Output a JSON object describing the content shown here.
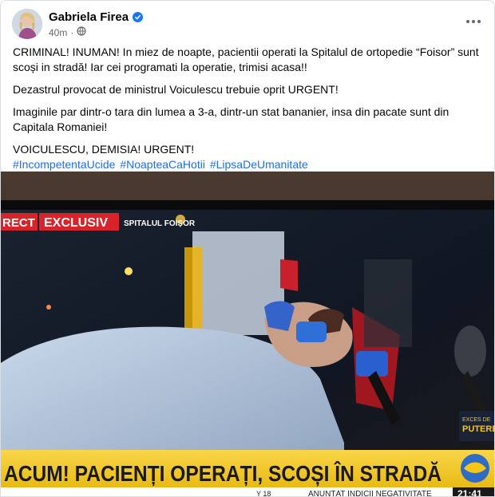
{
  "post": {
    "author": "Gabriela Firea",
    "time": "40m",
    "separator": "·",
    "paragraphs": [
      "CRIMINAL! INUMAN! In miez de noapte, pacientii operati la Spitalul de ortopedie “Foisor” sunt scoși in stradă! Iar cei programati la operatie, trimisi acasa!!",
      "Dezastrul provocat de ministrul Voiculescu trebuie oprit URGENT!",
      "Imaginile par dintr-o tara din lumea a 3-a, dintr-un stat bananier, insa din pacate sunt din Capitala Romaniei!",
      "VOICULESCU, DEMISIA! URGENT!"
    ],
    "hashtags": [
      "#IncompetentaUcide",
      "#NoapteaCaHotii",
      "#LipsaDeUmanitate"
    ]
  },
  "video": {
    "live_label": "RECT",
    "exclusive_label": "EXCLUSIV",
    "location": "SPITALUL FOIȘOR",
    "headline": "ACUM! PACIENȚI OPERAȚI, SCOȘI ÎN STRADĂ",
    "ticker": "ANUNȚAT INDICII NEGATIVITATE",
    "ticker_prefix": "Y 18",
    "clock": "21:41",
    "corner_text_1": "EXCES DE",
    "corner_text_2": "PUTERE"
  },
  "colors": {
    "link": "#216fdb",
    "verified": "#1877f2",
    "secondary_text": "#65676b",
    "news_red": "#d8232a",
    "news_banner": "#f5c518"
  },
  "icons": {
    "verified": "verified-badge-icon",
    "audience": "globe-icon",
    "more": "more-options-icon"
  }
}
